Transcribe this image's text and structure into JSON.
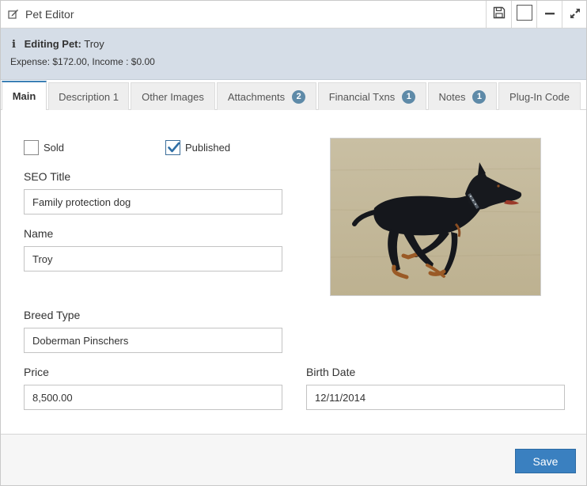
{
  "window": {
    "title": "Pet Editor",
    "icons": [
      "edit-icon",
      "save-icon",
      "square-icon",
      "minimize-icon",
      "expand-icon"
    ]
  },
  "info": {
    "editing_label": "Editing Pet:",
    "pet_name": "Troy",
    "financials": "Expense: $172.00, Income : $0.00"
  },
  "tabs": [
    {
      "label": "Main",
      "badge": null,
      "active": true
    },
    {
      "label": "Description 1",
      "badge": null,
      "active": false
    },
    {
      "label": "Other Images",
      "badge": null,
      "active": false
    },
    {
      "label": "Attachments",
      "badge": "2",
      "active": false
    },
    {
      "label": "Financial Txns",
      "badge": "1",
      "active": false
    },
    {
      "label": "Notes",
      "badge": "1",
      "active": false
    },
    {
      "label": "Plug-In Code",
      "badge": null,
      "active": false
    }
  ],
  "form": {
    "sold_label": "Sold",
    "sold_checked": false,
    "published_label": "Published",
    "published_checked": true,
    "seo_title_label": "SEO Title",
    "seo_title_value": "Family protection dog",
    "name_label": "Name",
    "name_value": "Troy",
    "breed_label": "Breed Type",
    "breed_value": "Doberman Pinschers",
    "price_label": "Price",
    "price_value": "8,500.00",
    "birth_date_label": "Birth Date",
    "birth_date_value": "12/11/2014"
  },
  "footer": {
    "save_label": "Save"
  },
  "colors": {
    "accent": "#3a80c0",
    "infobar": "#d5dde7",
    "badge": "#5e8aa8"
  }
}
